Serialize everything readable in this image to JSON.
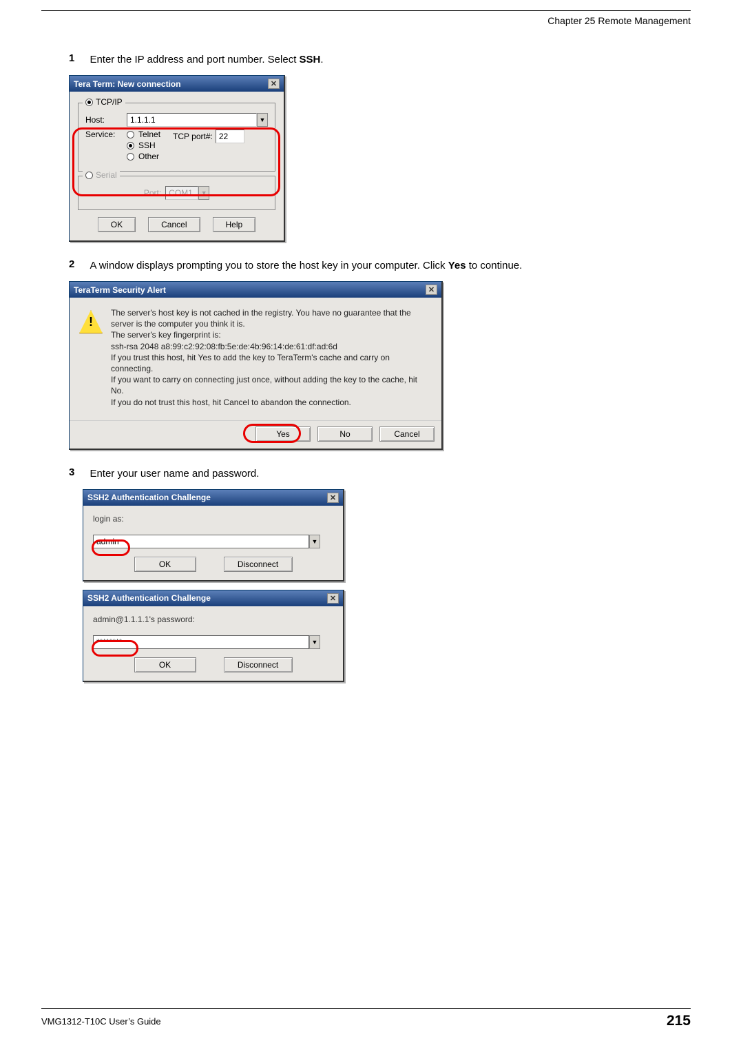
{
  "header": {
    "chapter": "Chapter 25 Remote Management"
  },
  "steps": {
    "s1": {
      "num": "1",
      "text_before": "Enter the IP address and port number. Select ",
      "bold": "SSH",
      "text_after": "."
    },
    "s2": {
      "num": "2",
      "text_before": " A window displays prompting you to store the host key in your computer. Click ",
      "bold": "Yes",
      "text_after": " to continue."
    },
    "s3": {
      "num": "3",
      "text": "Enter your user name and password."
    }
  },
  "dialog1": {
    "title": "Tera Term: New connection",
    "tcpip_label": "TCP/IP",
    "host_label": "Host:",
    "host_value": "1.1.1.1",
    "service_label": "Service:",
    "radio_telnet": "Telnet",
    "radio_ssh": "SSH",
    "radio_other": "Other",
    "tcpport_label": "TCP port#:",
    "tcpport_value": "22",
    "serial_label": "Serial",
    "port_label": "Port:",
    "port_value": "COM1",
    "btn_ok": "OK",
    "btn_cancel": "Cancel",
    "btn_help": "Help"
  },
  "dialog2": {
    "title": "TeraTerm Security Alert",
    "line1": "The server's host key is not cached in the registry. You have no guarantee that the server is the computer you think it is.",
    "line2": "The server's key fingerprint is:",
    "line3": "ssh-rsa 2048 a8:99:c2:92:08:fb:5e:de:4b:96:14:de:61:df:ad:6d",
    "line4": "If you trust this host, hit Yes to add the key to TeraTerm's cache and carry on connecting.",
    "line5": "If you want to carry on connecting just once, without adding the key to the cache, hit No.",
    "line6": "If you do not trust this host, hit Cancel to abandon the connection.",
    "btn_yes": "Yes",
    "btn_no": "No",
    "btn_cancel": "Cancel"
  },
  "dialog3": {
    "title": "SSH2 Authentication Challenge",
    "label": "login as:",
    "value": "admin",
    "btn_ok": "OK",
    "btn_disconnect": "Disconnect"
  },
  "dialog4": {
    "title": "SSH2 Authentication Challenge",
    "label": "admin@1.1.1.1's password:",
    "value": "********",
    "btn_ok": "OK",
    "btn_disconnect": "Disconnect"
  },
  "footer": {
    "guide": "VMG1312-T10C User’s Guide",
    "page": "215"
  }
}
